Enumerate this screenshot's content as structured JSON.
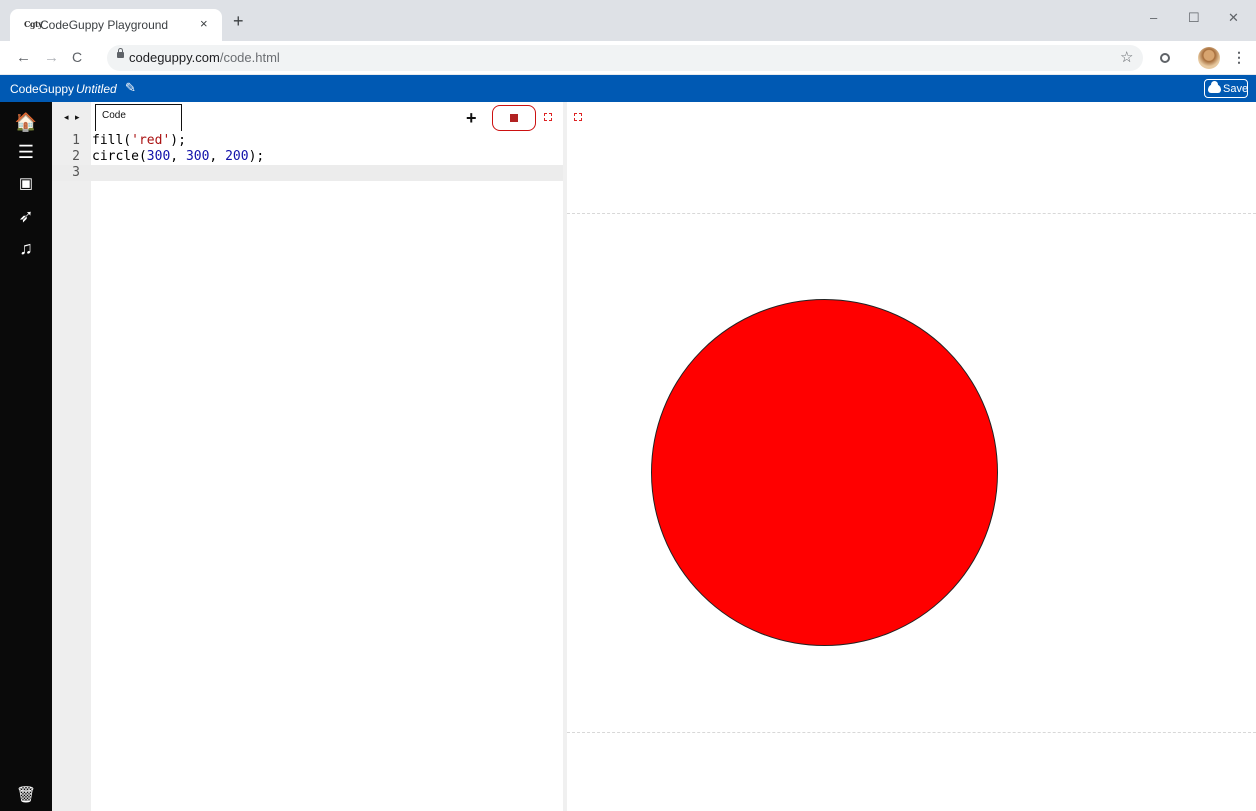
{
  "browser": {
    "tab_title": "CodeGuppy Playground",
    "tab_favicon": "Cgty",
    "tab_close": "×",
    "new_tab": "+",
    "window_controls": {
      "minimize": "–",
      "maximize": "☐",
      "close": "✕"
    },
    "nav": {
      "back": "←",
      "forward": "→",
      "reload": "C"
    },
    "url_host": "codeguppy.com",
    "url_path": "/code.html",
    "star": "☆",
    "menu": "⋮"
  },
  "app": {
    "brand": "CodeGuppy",
    "document_name": "Untitled",
    "edit_icon": "✎",
    "save_label": "Save"
  },
  "sidebar": {
    "items": [
      {
        "name": "home-icon",
        "glyph": "🏠"
      },
      {
        "name": "menu-icon",
        "glyph": "☰"
      },
      {
        "name": "image-icon",
        "glyph": "▣"
      },
      {
        "name": "rocket-icon",
        "glyph": "➶"
      },
      {
        "name": "music-icon",
        "glyph": "♫"
      }
    ],
    "trash_glyph": "🗑"
  },
  "editor": {
    "tab_nav": "◂ ▸",
    "tab_label": "Code",
    "add_glyph": "+",
    "lines": [
      {
        "num": "1",
        "parts": [
          {
            "t": "fill(",
            "c": "plain"
          },
          {
            "t": "'red'",
            "c": "str"
          },
          {
            "t": ");",
            "c": "plain"
          }
        ]
      },
      {
        "num": "2",
        "parts": [
          {
            "t": "circle(",
            "c": "plain"
          },
          {
            "t": "300",
            "c": "num"
          },
          {
            "t": ", ",
            "c": "plain"
          },
          {
            "t": "300",
            "c": "num"
          },
          {
            "t": ", ",
            "c": "plain"
          },
          {
            "t": "200",
            "c": "num"
          },
          {
            "t": ");",
            "c": "plain"
          }
        ]
      },
      {
        "num": "3",
        "parts": []
      }
    ],
    "active_line": 3
  },
  "output": {
    "circle_fill": "#ff0000"
  },
  "colors": {
    "appbar": "#0059b3",
    "sidebar": "#0a0a0a",
    "stop_border": "#cc1111"
  }
}
